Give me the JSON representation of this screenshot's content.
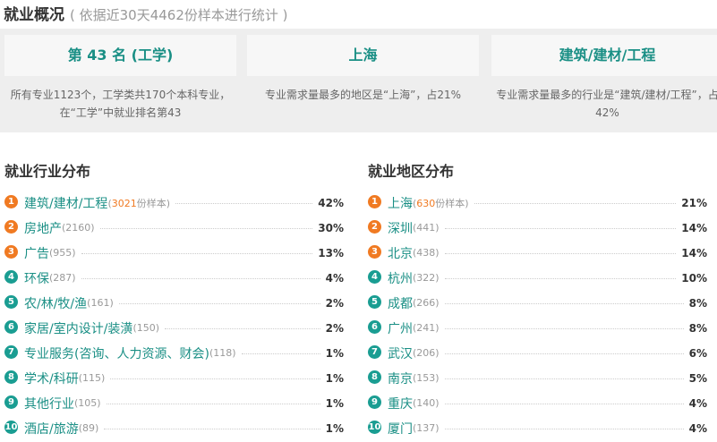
{
  "header": {
    "title": "就业概况",
    "subtitle": "( 依据近30天4462份样本进行统计 )"
  },
  "overview": [
    {
      "value": "第 43 名 (工学)",
      "desc": "所有专业1123个，工学类共170个本科专业，在“工学”中就业排名第43"
    },
    {
      "value": "上海",
      "desc": "专业需求量最多的地区是“上海”，占21%"
    },
    {
      "value": "建筑/建材/工程",
      "desc": "专业需求量最多的行业是“建筑/建材/工程”，占42%"
    }
  ],
  "industry": {
    "title": "就业行业分布",
    "sample_suffix": "份样本",
    "items": [
      {
        "rank": "1",
        "name": "建筑/建材/工程",
        "count": "3021",
        "pct": "42%"
      },
      {
        "rank": "2",
        "name": "房地产",
        "count": "(2160)",
        "pct": "30%"
      },
      {
        "rank": "3",
        "name": "广告",
        "count": "(955)",
        "pct": "13%"
      },
      {
        "rank": "4",
        "name": "环保",
        "count": "(287)",
        "pct": "4%"
      },
      {
        "rank": "5",
        "name": "农/林/牧/渔",
        "count": "(161)",
        "pct": "2%"
      },
      {
        "rank": "6",
        "name": "家居/室内设计/装潢",
        "count": "(150)",
        "pct": "2%"
      },
      {
        "rank": "7",
        "name": "专业服务(咨询、人力资源、财会)",
        "count": "(118)",
        "pct": "1%"
      },
      {
        "rank": "8",
        "name": "学术/科研",
        "count": "(115)",
        "pct": "1%"
      },
      {
        "rank": "9",
        "name": "其他行业",
        "count": "(105)",
        "pct": "1%"
      },
      {
        "rank": "10",
        "name": "酒店/旅游",
        "count": "(89)",
        "pct": "1%"
      }
    ]
  },
  "region": {
    "title": "就业地区分布",
    "sample_suffix": "份样本",
    "items": [
      {
        "rank": "1",
        "name": "上海",
        "count": "630",
        "pct": "21%"
      },
      {
        "rank": "2",
        "name": "深圳",
        "count": "(441)",
        "pct": "14%"
      },
      {
        "rank": "3",
        "name": "北京",
        "count": "(438)",
        "pct": "14%"
      },
      {
        "rank": "4",
        "name": "杭州",
        "count": "(322)",
        "pct": "10%"
      },
      {
        "rank": "5",
        "name": "成都",
        "count": "(266)",
        "pct": "8%"
      },
      {
        "rank": "6",
        "name": "广州",
        "count": "(241)",
        "pct": "8%"
      },
      {
        "rank": "7",
        "name": "武汉",
        "count": "(206)",
        "pct": "6%"
      },
      {
        "rank": "8",
        "name": "南京",
        "count": "(153)",
        "pct": "5%"
      },
      {
        "rank": "9",
        "name": "重庆",
        "count": "(140)",
        "pct": "4%"
      },
      {
        "rank": "10",
        "name": "厦门",
        "count": "(137)",
        "pct": "4%"
      }
    ]
  },
  "colors": {
    "accent": "#1a8f85",
    "hot": "#f07a22",
    "rank_normal": "#1a9d92"
  }
}
